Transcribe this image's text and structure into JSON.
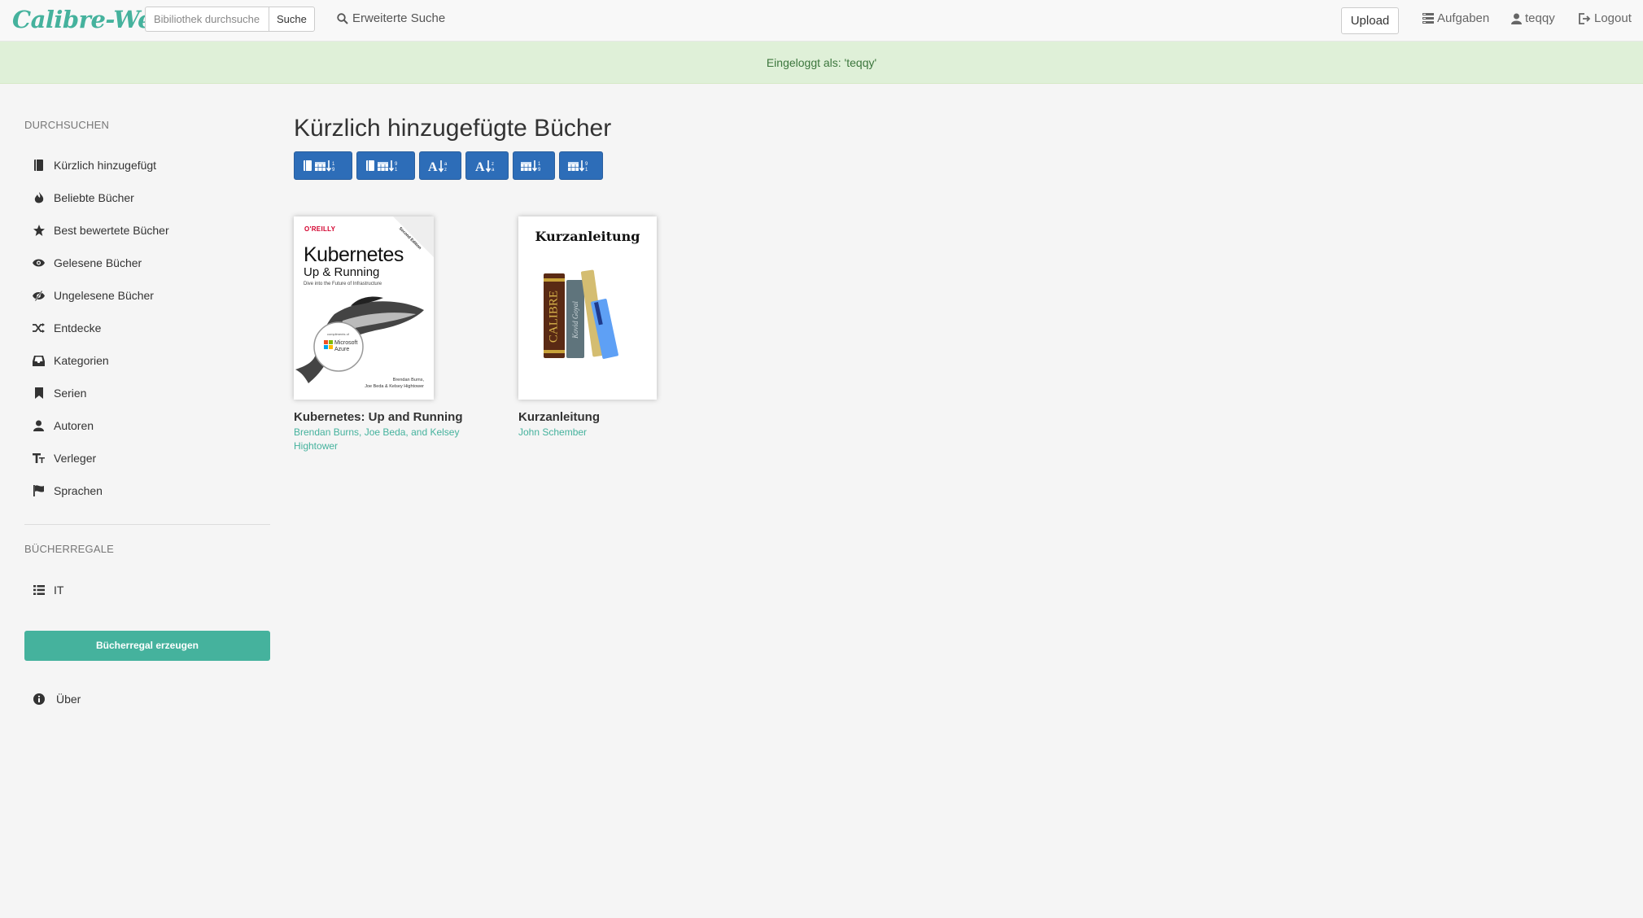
{
  "brand": "Calibre-Web",
  "search": {
    "placeholder": "Bibiliothek durchsuchen",
    "button": "Suche"
  },
  "advanced_search": "Erweiterte Suche",
  "nav": {
    "upload": "Upload",
    "tasks": "Aufgaben",
    "user": "teqqy",
    "logout": "Logout"
  },
  "alert": "Eingeloggt als: 'teqqy'",
  "sidebar": {
    "browse_heading": "DURCHSUCHEN",
    "items": [
      {
        "label": "Kürzlich hinzugefügt",
        "icon": "book-icon"
      },
      {
        "label": "Beliebte Bücher",
        "icon": "fire-icon"
      },
      {
        "label": "Best bewertete Bücher",
        "icon": "star-icon"
      },
      {
        "label": "Gelesene Bücher",
        "icon": "eye-icon"
      },
      {
        "label": "Ungelesene Bücher",
        "icon": "eye-slash-icon"
      },
      {
        "label": "Entdecke",
        "icon": "shuffle-icon"
      },
      {
        "label": "Kategorien",
        "icon": "inbox-icon"
      },
      {
        "label": "Serien",
        "icon": "bookmark-icon"
      },
      {
        "label": "Autoren",
        "icon": "user-icon"
      },
      {
        "label": "Verleger",
        "icon": "text-size-icon"
      },
      {
        "label": "Sprachen",
        "icon": "flag-icon"
      }
    ],
    "shelves_heading": "BÜCHERREGALE",
    "shelves": [
      {
        "label": "IT",
        "icon": "list-icon"
      }
    ],
    "create_shelf": "Bücherregal erzeugen",
    "about": "Über"
  },
  "main": {
    "title": "Kürzlich hinzugefügte Bücher",
    "sort_buttons": [
      "sort-book-date-desc-icon",
      "sort-book-date-asc-icon",
      "sort-alpha-asc-icon",
      "sort-alpha-desc-icon",
      "sort-pubdate-desc-icon",
      "sort-pubdate-asc-icon"
    ],
    "books": [
      {
        "title": "Kubernetes: Up and Running",
        "author_line1": "Brendan Burns, Joe Beda, and Kelsey",
        "author_line2": "Hightower",
        "cover": {
          "publisher": "O'REILLY",
          "edition": "Second Edition",
          "title": "Kubernetes",
          "subtitle": "Up & Running",
          "tagline": "Dive into the Future of Infrastructure",
          "compliments": "compliments of",
          "sponsor1": "Microsoft",
          "sponsor2": "Azure",
          "authors1": "Brendan Burns,",
          "authors2": "Joe Beda & Kelsey Hightower"
        }
      },
      {
        "title": "Kurzanleitung",
        "author_line1": "John Schember",
        "cover": {
          "title": "Kurzanleitung",
          "spine1": "CALIBRE",
          "spine2": "Kovid Goyal"
        }
      }
    ]
  },
  "colors": {
    "accent": "#45b29d",
    "primary": "#2d6db8",
    "alert_bg": "#dff0d8"
  }
}
